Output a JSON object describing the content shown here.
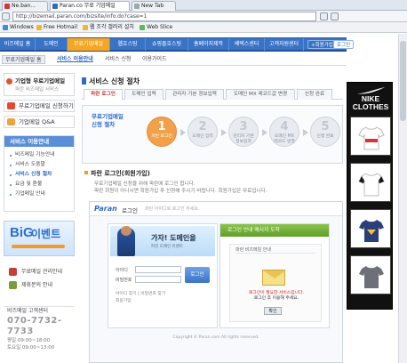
{
  "browser": {
    "tabs": [
      {
        "label": "Ne.ban..."
      },
      {
        "label": "Paran.co 무료 기업메일"
      },
      {
        "label": "New Tab"
      }
    ],
    "address": "http://bizemail.paran.com/bizsite/info.do?case=1",
    "bookmarks": [
      {
        "label": "Windows"
      },
      {
        "label": "Free Hotmail"
      },
      {
        "label": "웹 조각 갤러리 설치"
      },
      {
        "label": "Web Slice"
      }
    ]
  },
  "site": {
    "gnb": [
      {
        "label": "비즈메일 홈"
      },
      {
        "label": "도메인"
      },
      {
        "label": "무료기업메일"
      },
      {
        "label": "웹호스팅"
      },
      {
        "label": "쇼핑몰호스팅"
      },
      {
        "label": "홈페이지제작"
      },
      {
        "label": "쎄텍스센터"
      },
      {
        "label": "고객지원센터"
      }
    ],
    "gnb_right": [
      "+회원가입",
      "로그인"
    ],
    "lnb": [
      {
        "label": "무료기업메일 홈"
      },
      {
        "label": "서비스 이용안내"
      },
      {
        "label": "서비스 신청"
      },
      {
        "label": "이용가이드"
      }
    ]
  },
  "left": {
    "profile_title": "기업형 무료기업메일",
    "profile_sub": "파란 비즈메일 서비스",
    "btn1": "무료기업메일 신청하기",
    "btn2": "기업메일 Q&A",
    "menu_title": "서비스 이용안내",
    "menu_items": [
      "비즈메일 기능안내",
      "서비스 도움말",
      "서비스 신청 절차",
      "요금 및 환불",
      "기업메일 안내"
    ],
    "event_big": "BiG",
    "event_word": "이벤트",
    "line1": "무료메일 관리안내",
    "line2": "제휴문의 안내",
    "cs_title": "비즈메일 고객센터",
    "cs_phone": "070-7732-7733",
    "cs_hours": [
      "평일 09:00~18:00",
      "토요일 09:00~13:00"
    ]
  },
  "main": {
    "title": "서비스 신청 절차",
    "subtabs": [
      "파란 로그인",
      "도메인 입력",
      "관리자 기본 정보입력",
      "도메인 MX 레코드값 변경",
      "신청 완료"
    ],
    "process_title": "무료기업메일\n신청 절차",
    "steps": [
      {
        "num": "1",
        "label": "파란 로그인"
      },
      {
        "num": "2",
        "label": "도메인 입력"
      },
      {
        "num": "3",
        "label": "관리자 기본 정보입력"
      },
      {
        "num": "4",
        "label": "도메인 MX 레코드 변경"
      },
      {
        "num": "5",
        "label": "신청 완료"
      }
    ],
    "notice_title": "파란 로그인(회원가입)",
    "notice_lines": [
      "무료기업메일 신청을 위해 파란에 로그인 합니다.",
      "파란 회원이 아니시면 회원가입 후 신청해 주시기 바랍니다. 회원가입은 무료입니다."
    ],
    "paran": {
      "logo": "Paran",
      "title": "로그인",
      "desc": "파란 아이디로 로그인 하세요.",
      "slogan": "가자! 도메인을",
      "banner_sub": "파란 도메인 이벤트",
      "id_label": "아이디",
      "pw_label": "비밀번호",
      "login_btn": "로그인",
      "links": [
        "아이디 찾기 | 비밀번호 찾기",
        "회원가입"
      ],
      "notify_title": "로그인 안내 메시지 도착",
      "notify_inner": "파란 비즈메일 안내",
      "notify_msg_red": "로그인이 필요한 서비스입니다.",
      "notify_msg": "로그인 후 이용해 주세요.",
      "ok_btn": "확인",
      "footer": "Copyright © Paran.com All rights reserved."
    }
  },
  "ad": {
    "brand": "NIKE",
    "line2": "CLOTHES",
    "shirts": [
      "#d9323a",
      "#1a1a1a",
      "#2a3f7a",
      "#6d7077"
    ]
  }
}
